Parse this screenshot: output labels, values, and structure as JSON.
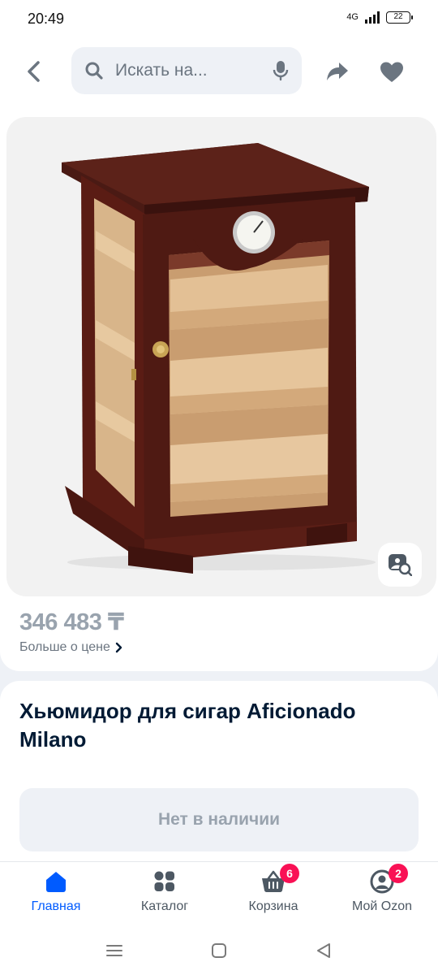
{
  "status": {
    "time": "20:49",
    "network": "4G",
    "battery": "22"
  },
  "top_bar": {
    "search_placeholder": "Искать на..."
  },
  "product": {
    "price": "346 483 ₸",
    "price_more": "Больше о цене",
    "title": "Хьюмидор для сигар Aficionado Milano",
    "availability": "Нет в наличии"
  },
  "tabs": [
    {
      "label": "Главная",
      "icon": "home-icon",
      "active": true
    },
    {
      "label": "Каталог",
      "icon": "catalog-icon",
      "active": false
    },
    {
      "label": "Корзина",
      "icon": "cart-icon",
      "badge": "6",
      "active": false
    },
    {
      "label": "Мой Ozon",
      "icon": "profile-icon",
      "badge": "2",
      "active": false
    }
  ],
  "colors": {
    "accent": "#005bff",
    "badge": "#f91155",
    "text": "#001a34",
    "muted": "#99a3ae"
  }
}
